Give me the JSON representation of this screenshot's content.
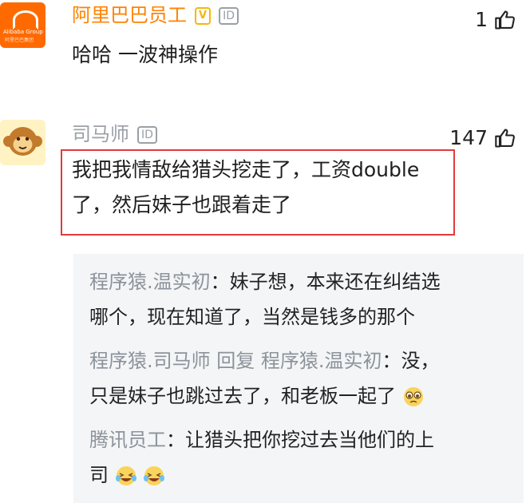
{
  "comments": [
    {
      "avatar_icon": "alibaba-logo-avatar",
      "avatar_logo_text": "Alibaba Group",
      "avatar_logo_sub": "阿里巴巴集团",
      "author": "阿里巴巴员工",
      "verified_badge": "V",
      "id_badge": "ID",
      "text": "哈哈 一波神操作",
      "likes": "1"
    },
    {
      "avatar_icon": "monkey-avatar",
      "author": "司马师",
      "id_badge": "ID",
      "text_line1": "我把我情敌给猎头挖走了，工资double",
      "text_line2": "了，然后妹子也跟着走了",
      "likes": "147"
    }
  ],
  "replies": [
    {
      "author": "程序猿.温实初",
      "sep": "：",
      "text_a": "妹子想，本来还在纠结选",
      "text_b": "哪个，现在知道了，当然是钱多的那个"
    },
    {
      "author": "程序猿.司马师 回复 程序猿.温实初",
      "sep": "：",
      "text_a": "没，",
      "text_b": "只是妹子也跳过去了，和老板一起了",
      "emoji": "crying-face-emoji"
    },
    {
      "author": "腾讯员工",
      "sep": "：",
      "text_a": "让猎头把你挖过去当他们的上",
      "text_b": "司",
      "emoji": "laughing-tears-emoji"
    }
  ],
  "colors": {
    "accent_orange": "#ff8200",
    "highlight_red": "#e23a3a",
    "reply_bg": "#f4f5f6"
  }
}
